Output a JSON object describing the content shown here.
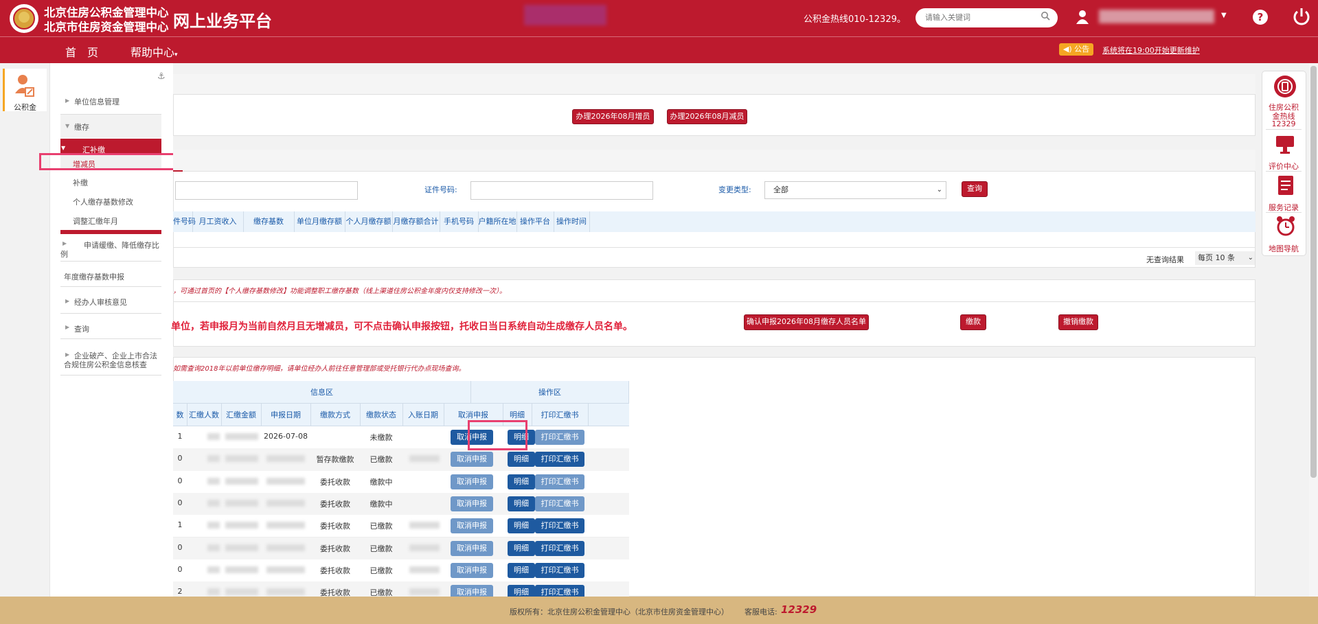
{
  "header": {
    "org_name_1": "北京住房公积金管理中心",
    "org_name_2": "北京市住房资金管理中心",
    "platform_title": "网上业务平台",
    "hotline": "公积金热线010-12329。",
    "search_placeholder": "请输入关键词"
  },
  "nav": {
    "home": "首　页",
    "help": "帮助中心",
    "notice_badge": "公告",
    "notice_text": "系统将在19:00开始更新维护"
  },
  "left_tab": {
    "label": "公积金"
  },
  "sidebar": {
    "unit_info": "单位信息管理",
    "contribution": "缴存",
    "summary_contrib": "汇补缴",
    "add_remove": "增减员",
    "supplement": "补缴",
    "base_modify": "个人缴存基数修改",
    "adjust_month": "调整汇缴年月",
    "reduce_ratio": "申请缓缴、降低缴存比",
    "reduce_ratio_2": "例",
    "annual_base": "年度缴存基数申报",
    "agent_review": "经办人审核意见",
    "query": "查询",
    "bankruptcy_1": "企业破产、企业上市合法",
    "bankruptcy_2": "合规住房公积金信息核查"
  },
  "panel1": {
    "btn_add": "办理2026年08月增员",
    "btn_remove": "办理2026年08月减员"
  },
  "panel2": {
    "id_label": "证件号码:",
    "change_type_label": "变更类型:",
    "change_type_value": "全部",
    "query_btn": "查询",
    "columns": [
      "件号码",
      "月工资收入",
      "缴存基数",
      "单位月缴存额",
      "个人月缴存额",
      "月缴存额合计",
      "手机号码",
      "户籍所在地",
      "操作平台",
      "操作时间"
    ],
    "no_result": "无查询结果",
    "per_page": "每页",
    "per_page_value": "10",
    "per_page_unit": "条"
  },
  "panel3": {
    "notice": "，可通过首页的【个人缴存基数修改】功能调整职工缴存基数（线上渠道住房公积金年度内仅支持修改一次）。",
    "big_notice": "单位，若申报月为当前自然月且无增减员，可不点击确认申报按钮，托收日当日系统自动生成缴存人员名单。",
    "btn_confirm": "确认申报2026年08月缴存人员名单",
    "btn_pay": "缴款",
    "btn_cancel_pay": "撤销缴款"
  },
  "panel4": {
    "notice": "如需查询2018年以前单位缴存明细，请单位经办人前往任意管理部或受托银行代办点现场查询。",
    "group_info": "信息区",
    "group_ops": "操作区",
    "columns": [
      "数",
      "汇缴人数",
      "汇缴金额",
      "申报日期",
      "缴款方式",
      "缴款状态",
      "入账日期",
      "取消申报",
      "明细",
      "打印汇缴书"
    ],
    "btn_cancel": "取消申报",
    "btn_detail": "明细",
    "btn_print": "打印汇缴书",
    "rows": [
      {
        "n": "1",
        "date": "2026-07-08",
        "method": "",
        "status": "未缴款",
        "cancel_active": true,
        "print_active": false
      },
      {
        "n": "0",
        "date": "",
        "method": "暂存款缴款",
        "status": "已缴款",
        "cancel_active": false,
        "print_active": true
      },
      {
        "n": "0",
        "date": "",
        "method": "委托收款",
        "status": "缴款中",
        "cancel_active": false,
        "print_active": false
      },
      {
        "n": "0",
        "date": "",
        "method": "委托收款",
        "status": "缴款中",
        "cancel_active": false,
        "print_active": false
      },
      {
        "n": "1",
        "date": "",
        "method": "委托收款",
        "status": "已缴款",
        "cancel_active": false,
        "print_active": true
      },
      {
        "n": "0",
        "date": "",
        "method": "委托收款",
        "status": "已缴款",
        "cancel_active": false,
        "print_active": true
      },
      {
        "n": "0",
        "date": "",
        "method": "委托收款",
        "status": "已缴款",
        "cancel_active": false,
        "print_active": true
      },
      {
        "n": "2",
        "date": "",
        "method": "委托收款",
        "status": "已缴款",
        "cancel_active": false,
        "print_active": true
      }
    ]
  },
  "right_dock": {
    "hotline_1": "住房公积",
    "hotline_2": "金热线",
    "hotline_3": "12329",
    "evaluation": "评价中心",
    "service_record": "服务记录",
    "map_nav": "地图导航"
  },
  "footer": {
    "copyright": "版权所有：北京住房公积金管理中心（北京市住房资金管理中心）",
    "phone_label": "客服电话:",
    "phone": "12329"
  },
  "colors": {
    "brand_red": "#bd1a2e",
    "button_blue": "#1e5aa0",
    "highlight": "#e83f6f",
    "footer": "#d8b780"
  }
}
